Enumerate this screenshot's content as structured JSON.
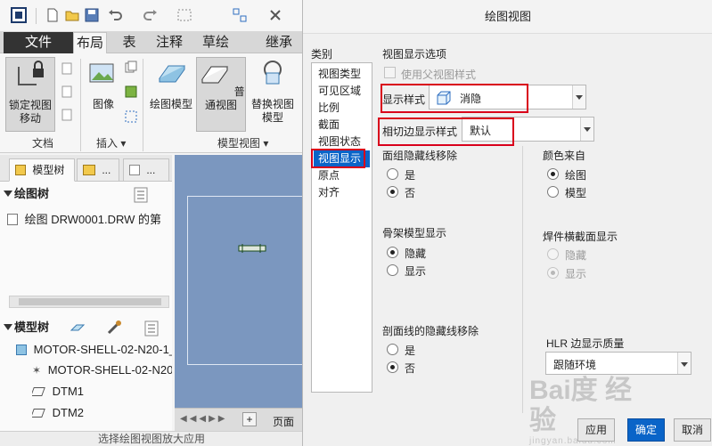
{
  "app": {
    "menus": [
      "文件",
      "布局",
      "表",
      "注释",
      "草绘",
      "继承迁"
    ],
    "ribbon": {
      "buttons": [
        "锁定视图移动",
        "图像",
        "绘图模型",
        "普通视图",
        "替换视图模型"
      ],
      "groups": [
        "文档",
        "插入",
        "模型视图"
      ]
    },
    "nav_tabs": [
      "模型树",
      "...",
      "..."
    ],
    "drawing_tree": {
      "title": "绘图树",
      "items": [
        "绘图 DRW0001.DRW 的第"
      ]
    },
    "model_tree": {
      "title": "模型树",
      "items": [
        "MOTOR-SHELL-02-N20-1_",
        "MOTOR-SHELL-02-N20",
        "DTM1",
        "DTM2"
      ]
    },
    "page_tab": "页面",
    "status_text": "选择绘图视图放大应用"
  },
  "dialog": {
    "title": "绘图视图",
    "category_label": "类别",
    "categories": [
      "视图类型",
      "可见区域",
      "比例",
      "截面",
      "视图状态",
      "视图显示",
      "原点",
      "对齐"
    ],
    "selected_category": "视图显示",
    "section_title": "视图显示选项",
    "use_parent_style": "使用父视图样式",
    "display_style": {
      "label": "显示样式",
      "value": "消隐"
    },
    "tangent_edge": {
      "label": "相切边显示样式",
      "value": "默认"
    },
    "face_group_hidden": {
      "label": "面组隐藏线移除",
      "options": [
        "是",
        "否"
      ],
      "selected": 1
    },
    "color_from": {
      "label": "颜色来自",
      "options": [
        "绘图",
        "模型"
      ],
      "selected": 0
    },
    "skeleton": {
      "label": "骨架模型显示",
      "options": [
        "隐藏",
        "显示"
      ],
      "selected": 0
    },
    "weld_section": {
      "label": "焊件横截面显示",
      "options": [
        "隐藏",
        "显示"
      ],
      "selected": 1
    },
    "xhatch_hidden": {
      "label": "剖面线的隐藏线移除",
      "options": [
        "是",
        "否"
      ],
      "selected": 1
    },
    "hlr_quality": {
      "label": "HLR 边显示质量",
      "value": "跟随环境"
    },
    "buttons": {
      "apply": "应用",
      "ok": "确定",
      "cancel": "取消"
    },
    "watermark": {
      "main": "Bai度 经验",
      "sub": "jingyan.baidu.com"
    }
  },
  "colors": {
    "accent": "#0a64c8",
    "highlight": "#d9001b",
    "canvas": "#7b97bf"
  }
}
